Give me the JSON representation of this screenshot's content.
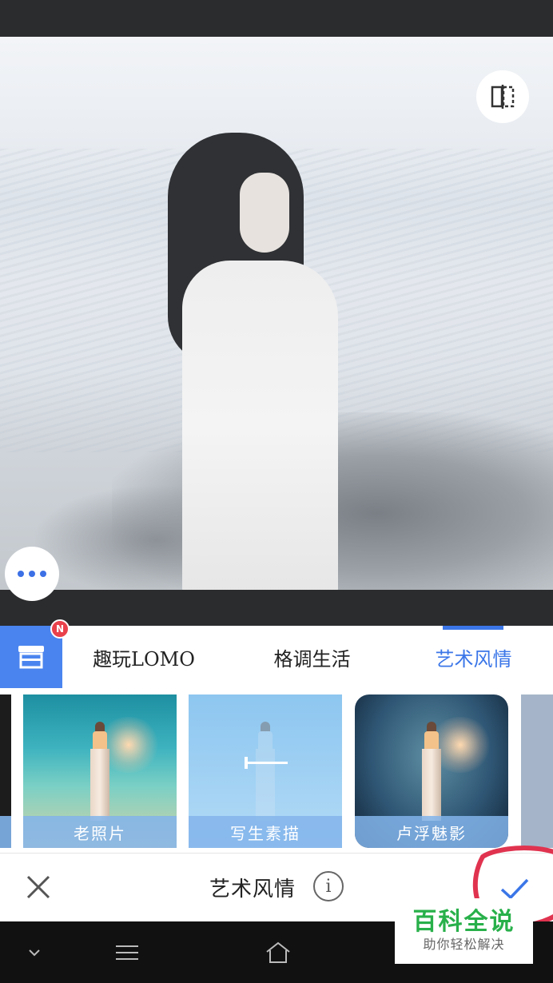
{
  "filter_tabs": [
    {
      "label": "趣玩LOMO"
    },
    {
      "label": "格调生活"
    },
    {
      "label": "艺术风情"
    }
  ],
  "active_tab_index": 2,
  "store": {
    "badge": "N"
  },
  "filters": [
    {
      "label": "老照片"
    },
    {
      "label": "写生素描"
    },
    {
      "label": "卢浮魅影"
    }
  ],
  "selected_filter": "写生素描",
  "action_bar": {
    "title": "艺术风情",
    "info_glyph": "i"
  },
  "watermark": {
    "main": "百科全说",
    "sub": "助你轻松解决"
  },
  "colors": {
    "accent": "#3b76e8",
    "badge": "#e9414c",
    "watermark_green": "#28b04a",
    "annotation_red": "#e0334f"
  },
  "icons": {
    "compare": "compare-icon",
    "more": "more-dots-icon",
    "store": "store-icon",
    "close": "close-icon",
    "info": "info-icon",
    "confirm": "check-icon",
    "nav_back": "chevron-down-icon",
    "nav_menu": "menu-icon",
    "nav_home": "home-icon"
  }
}
